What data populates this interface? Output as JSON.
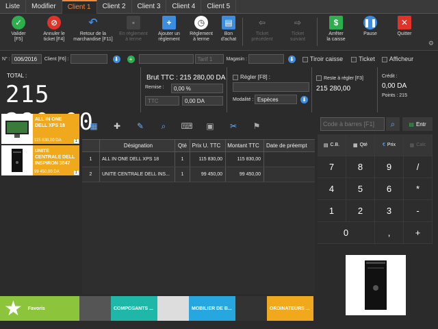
{
  "tabs": [
    {
      "label": "Liste",
      "active": false
    },
    {
      "label": "Modifier",
      "active": false
    },
    {
      "label": "Client 1",
      "active": true
    },
    {
      "label": "Client 2",
      "active": false
    },
    {
      "label": "Client 3",
      "active": false
    },
    {
      "label": "Client 4",
      "active": false
    },
    {
      "label": "Client 5",
      "active": false
    }
  ],
  "toolbar": {
    "valider": "Valider\n[F5]",
    "annuler": "Annuler le\nticket [F4]",
    "retour": "Retour de la\nmarchandise [F11]",
    "reglement_disabled": "En règlement\nà terme",
    "ajouter_reglement": "Ajouter un\nrèglement",
    "reglement_terme": "Règlement\nà terme",
    "bon_achat": "Bon\nd'achat",
    "ticket_precedent": "Ticket\nprécédent",
    "ticket_suivant": "Ticket\nsuivant",
    "arreter_caisse": "Arrêter\nla caisse",
    "pause": "Pause",
    "quitter": "Quitter"
  },
  "info": {
    "num_label": "N° :",
    "num_value": "006/2016",
    "client_label": "Client [F6] :",
    "client_value": "",
    "tarif_placeholder": "Tarif 1",
    "magasin_label": "Magasin :",
    "magasin_value": "",
    "tiroir_label": "Tiroir caisse",
    "ticket_label": "Ticket",
    "afficheur_label": "Afficheur"
  },
  "totals": {
    "total_label": "TOTAL :",
    "total_value": "215 280,00",
    "brut_label": "Brut TTC :",
    "brut_value": "215 280,00 DA",
    "remise_label": "Remise :",
    "remise_value": "0,00 %",
    "ttc_placeholder": "TTC",
    "ttc_value": "0,00 DA",
    "regler_label": "Régler [F8] :",
    "regler_value": "",
    "modalite_label": "Modalité :",
    "modalite_value": "Espèces",
    "reste_label": "Reste à régler [F3]",
    "reste_value": "215 280,00",
    "credit_label": "Crédit :",
    "credit_value": "0,00 DA",
    "points_label": "Points : 215"
  },
  "tiles": [
    {
      "name": "ALL IN ONE\nDELL XPS 18",
      "price": "115 830,00 DA",
      "qty": "1"
    },
    {
      "name": "UNITE\nCENTRALE DELL\nINSPIRON 3847",
      "price": "99 450,00 DA",
      "qty": "1"
    }
  ],
  "grid": {
    "headers": [
      "",
      "Désignation",
      "Qté",
      "Prix U. TTC",
      "Montant TTC",
      "Date de préempt"
    ],
    "rows": [
      [
        "1",
        "ALL IN ONE DELL XPS 18",
        "1",
        "115 830,00",
        "115 830,00",
        ""
      ],
      [
        "2",
        "UNITE CENTRALE DELL INS...",
        "1",
        "99 450,00",
        "99 450,00",
        ""
      ]
    ]
  },
  "keypad": {
    "barcode_placeholder": "Code à barres [F1]",
    "enter_label": "Entr",
    "cb_label": "C.B.",
    "qte_label": "Qté",
    "prix_label": "Prix",
    "calc_label": "Calc",
    "keys": [
      [
        "7",
        "8",
        "9",
        "/"
      ],
      [
        "4",
        "5",
        "6",
        "*"
      ],
      [
        "1",
        "2",
        "3",
        "-"
      ],
      [
        "0",
        ",",
        "+"
      ]
    ]
  },
  "categories": [
    {
      "label": "Favoris",
      "color": "#8cc43c"
    },
    {
      "label": "COMPOSANTS ...",
      "color": "#1fb8a8"
    },
    {
      "label": "MOBILIER DE B...",
      "color": "#27a7e0"
    },
    {
      "label": "ORDINATEURS ...",
      "color": "#f0a81c"
    }
  ],
  "colors": {
    "accent": "#f08a3c",
    "tile": "#f0a81c"
  }
}
